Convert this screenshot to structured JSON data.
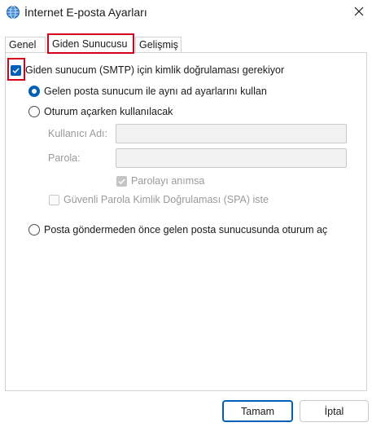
{
  "window": {
    "title": "İnternet E-posta Ayarları",
    "icon": "globe-mail-icon",
    "close_icon": "close-icon"
  },
  "tabs": [
    {
      "label": "Genel",
      "selected": false
    },
    {
      "label": "Giden Sunucusu",
      "selected": true
    },
    {
      "label": "Gelişmiş",
      "selected": false
    }
  ],
  "outgoing": {
    "require_auth_label": "Giden sunucum (SMTP) için kimlik doğrulaması gerekiyor",
    "require_auth_checked": true,
    "same_settings_label": "Gelen posta sunucum ile aynı ad ayarlarını kullan",
    "logon_label": "Oturum açarken kullanılacak",
    "username_label": "Kullanıcı Adı:",
    "username_value": "",
    "password_label": "Parola:",
    "password_value": "",
    "remember_password_label": "Parolayı anımsa",
    "remember_password_checked": true,
    "spa_label": "Güvenli Parola Kimlik Doğrulaması (SPA) iste",
    "spa_checked": false,
    "logon_incoming_first_label": "Posta göndermeden önce gelen posta sunucusunda oturum aç",
    "selected_option": "same_settings"
  },
  "buttons": {
    "ok_label": "Tamam",
    "cancel_label": "İptal"
  },
  "colors": {
    "accent": "#005fb8",
    "highlight": "#d6001c"
  }
}
